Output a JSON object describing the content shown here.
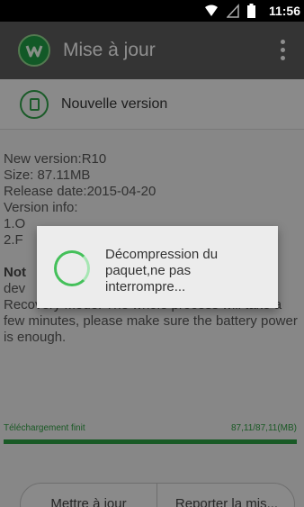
{
  "status_bar": {
    "time": "11:56",
    "icons": [
      "wifi-icon",
      "signal-icon",
      "battery-icon"
    ]
  },
  "app_bar": {
    "title": "Mise à jour",
    "logo_icon": "app-logo-icon",
    "menu_icon": "overflow-menu-icon"
  },
  "section": {
    "title": "Nouvelle version",
    "icon": "document-icon"
  },
  "info": {
    "lines": [
      "New version:R10",
      "Size: 87.11MB",
      "Release date:2015-04-20",
      "Version info:",
      "1.O",
      "2.F"
    ],
    "note_visible": [
      "Not",
      "dev",
      "Recovery Mode. The whole process will take a few minutes, please make sure the battery power is enough."
    ]
  },
  "progress": {
    "label": "Téléchargement finit",
    "value_text": "87,11/87,11(MB)",
    "fraction": 1.0
  },
  "buttons": {
    "update_label": "Mettre à jour",
    "postpone_label": "Reporter la mis..."
  },
  "dialog": {
    "message": "Décompression du paquet,ne pas interrompre..."
  },
  "colors": {
    "accent": "#2c9b43",
    "app_bar": "#5b5b5b",
    "background": "#e8e8e8"
  }
}
